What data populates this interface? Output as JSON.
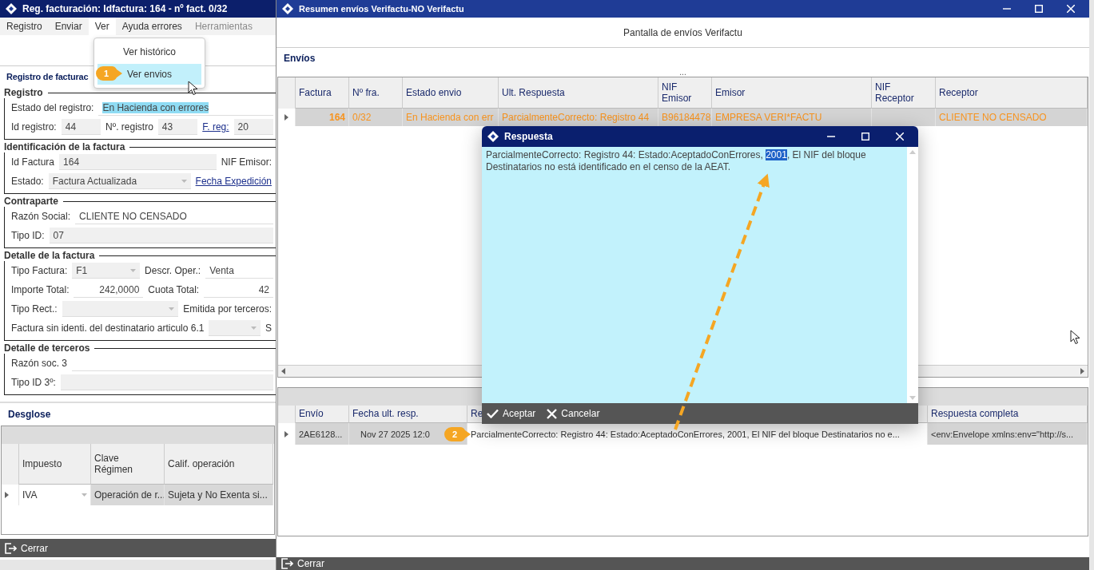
{
  "left_window": {
    "title": "Reg. facturación: Idfactura: 164 - nº fact. 0/32",
    "menu": [
      {
        "label": "Registro",
        "selected": false,
        "disabled": false
      },
      {
        "label": "Enviar",
        "selected": false,
        "disabled": false
      },
      {
        "label": "Ver",
        "selected": true,
        "disabled": false
      },
      {
        "label": "Ayuda errores",
        "selected": false,
        "disabled": false
      },
      {
        "label": "Herramientas",
        "selected": false,
        "disabled": true
      }
    ],
    "heading": "Registro de facturac",
    "sections": [
      {
        "title": "Registro",
        "rows": [
          {
            "items": [
              {
                "kind": "label",
                "text": "Estado del registro:"
              },
              {
                "kind": "selected-input",
                "text": "En Hacienda con errores"
              }
            ]
          },
          {
            "items": [
              {
                "kind": "label",
                "text": "Id registro:"
              },
              {
                "kind": "input",
                "text": "44"
              },
              {
                "kind": "label",
                "text": "Nº. registro"
              },
              {
                "kind": "input",
                "text": "43"
              },
              {
                "kind": "link",
                "text": "F. reg:"
              },
              {
                "kind": "input",
                "text": "20"
              }
            ]
          }
        ]
      },
      {
        "title": "Identificación de la factura",
        "rows": [
          {
            "items": [
              {
                "kind": "label",
                "text": "Id Factura"
              },
              {
                "kind": "input",
                "text": "164"
              },
              {
                "kind": "label",
                "text": "NIF Emisor:"
              }
            ]
          },
          {
            "items": [
              {
                "kind": "label",
                "text": "Estado:"
              },
              {
                "kind": "select",
                "text": "Factura Actualizada"
              },
              {
                "kind": "link",
                "text": "Fecha Expedición"
              }
            ]
          }
        ]
      },
      {
        "title": "Contraparte",
        "rows": [
          {
            "items": [
              {
                "kind": "label",
                "text": "Razón Social:"
              },
              {
                "kind": "plain-input",
                "text": "CLIENTE NO CENSADO"
              }
            ]
          },
          {
            "items": [
              {
                "kind": "label",
                "text": "Tipo ID:"
              },
              {
                "kind": "input",
                "text": "07"
              }
            ]
          }
        ]
      },
      {
        "title": "Detalle de la factura",
        "rows": [
          {
            "items": [
              {
                "kind": "label",
                "text": "Tipo Factura:"
              },
              {
                "kind": "select",
                "text": "F1"
              },
              {
                "kind": "label",
                "text": "Descr. Oper.:"
              },
              {
                "kind": "plain-input",
                "text": "Venta"
              }
            ]
          },
          {
            "items": [
              {
                "kind": "label",
                "text": "Importe Total:"
              },
              {
                "kind": "number-input",
                "text": "242,0000"
              },
              {
                "kind": "label",
                "text": "Cuota Total:"
              },
              {
                "kind": "number-input",
                "text": "42"
              }
            ]
          },
          {
            "items": [
              {
                "kind": "label",
                "text": "Tipo Rect.:"
              },
              {
                "kind": "select"
              },
              {
                "kind": "label",
                "text": "Emitida por terceros:"
              }
            ]
          },
          {
            "items": [
              {
                "kind": "label",
                "text": "Factura sin identi. del destinatario articulo 6.1"
              },
              {
                "kind": "select"
              },
              {
                "kind": "label",
                "text": "S"
              }
            ]
          }
        ]
      },
      {
        "title": "Detalle de terceros",
        "rows": [
          {
            "items": [
              {
                "kind": "label",
                "text": "Razón soc. 3"
              },
              {
                "kind": "plain-input"
              }
            ]
          },
          {
            "items": [
              {
                "kind": "label",
                "text": "Tipo ID 3º:"
              },
              {
                "kind": "input"
              }
            ]
          }
        ]
      }
    ],
    "desglose": {
      "title": "Desglose",
      "columns": [
        "Impuesto",
        "Clave\nRégimen",
        "Calif. operación"
      ],
      "rows": [
        {
          "cells": [
            {
              "kind": "select",
              "text": "IVA"
            },
            {
              "kind": "text",
              "text": "Operación de r..."
            },
            {
              "kind": "text",
              "text": "Sujeta y No Exenta si..."
            }
          ]
        }
      ]
    },
    "close_button": "Cerrar"
  },
  "view_menu": {
    "items": [
      {
        "label": "Ver histórico",
        "selected": false
      },
      {
        "label": "Ver envios",
        "selected": true
      }
    ]
  },
  "right_window": {
    "title": "Resumen envíos Verifactu-NO Verifactu",
    "subtitle": "Pantalla de envíos Verifactu",
    "section": "Envíos",
    "more": "...",
    "envios_table": {
      "columns": [
        "Factura",
        "Nº fra.",
        "Estado envio",
        "Ult. Respuesta",
        "NIF\nEmisor",
        "Emisor",
        "NIF\nReceptor",
        "Receptor"
      ],
      "rows": [
        {
          "cells": [
            {
              "kind": "number",
              "text": "164"
            },
            {
              "kind": "text",
              "text": "0/32"
            },
            {
              "kind": "text",
              "text": "En Hacienda con err"
            },
            {
              "kind": "text",
              "text": "ParcialmenteCorrecto:  Registro 44"
            },
            {
              "kind": "text",
              "text": "B96184478"
            },
            {
              "kind": "text",
              "text": "EMPRESA VERI*FACTU"
            },
            {
              "kind": "text"
            },
            {
              "kind": "text",
              "text": "CLIENTE NO CENSADO"
            }
          ]
        }
      ]
    },
    "responses_table": {
      "columns": [
        "Envío",
        "Fecha ult. resp.",
        "Re",
        "Respuesta completa"
      ],
      "rows": [
        {
          "cells": [
            {
              "kind": "text",
              "text": "2AE6128...",
              "focused": false
            },
            {
              "kind": "date",
              "text": "Nov 27 2025 12:0",
              "focused": false
            },
            {
              "kind": "text",
              "text": "ParcialmenteCorrecto:  Registro 44: Estado:AceptadoConErrores, 2001, El NIF del bloque Destinatarios no e...",
              "focused": true
            },
            {
              "kind": "text",
              "text": "<env:Envelope xmlns:env=\"http://s...",
              "focused": false
            }
          ]
        }
      ]
    },
    "close_button": "Cerrar"
  },
  "dialog": {
    "title": "Respuesta",
    "text_before": "ParcialmenteCorrecto:  Registro 44: Estado:AceptadoConErrores, ",
    "selection": "2001",
    "text_after": ", El NIF del bloque Destinatarios no está identificado en el censo de la AEAT.",
    "buttons": [
      {
        "kind": "accept",
        "label": "Aceptar"
      },
      {
        "kind": "cancel",
        "label": "Cancelar"
      }
    ]
  },
  "callouts": [
    {
      "label": "1"
    },
    {
      "label": "2"
    }
  ]
}
